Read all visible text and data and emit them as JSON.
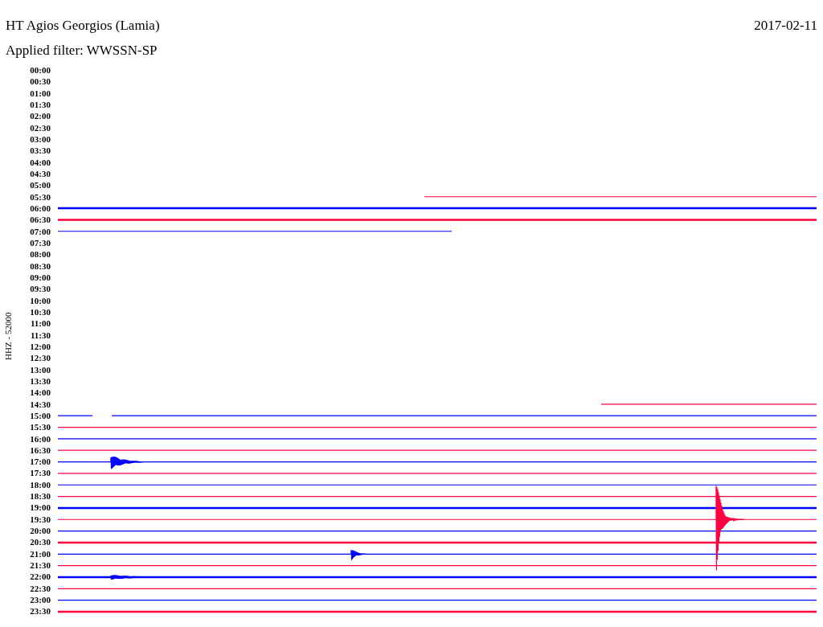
{
  "header": {
    "title": "HT Agios Georgios (Lamia)",
    "date": "2017-02-11"
  },
  "filter": "Applied filter: WWSSN-SP",
  "axis_label": "HHZ - 52000",
  "time_labels": [
    "00:00",
    "00:30",
    "01:00",
    "01:30",
    "02:00",
    "02:30",
    "03:00",
    "03:30",
    "04:00",
    "04:30",
    "05:00",
    "05:30",
    "06:00",
    "06:30",
    "07:00",
    "07:30",
    "08:00",
    "08:30",
    "09:00",
    "09:30",
    "10:00",
    "10:30",
    "11:00",
    "11:30",
    "12:00",
    "12:30",
    "13:00",
    "13:30",
    "14:00",
    "14:30",
    "15:00",
    "15:30",
    "16:00",
    "16:30",
    "17:00",
    "17:30",
    "18:00",
    "18:30",
    "19:00",
    "19:30",
    "20:00",
    "20:30",
    "21:00",
    "21:30",
    "22:00",
    "22:30",
    "23:00",
    "23:30"
  ]
}
